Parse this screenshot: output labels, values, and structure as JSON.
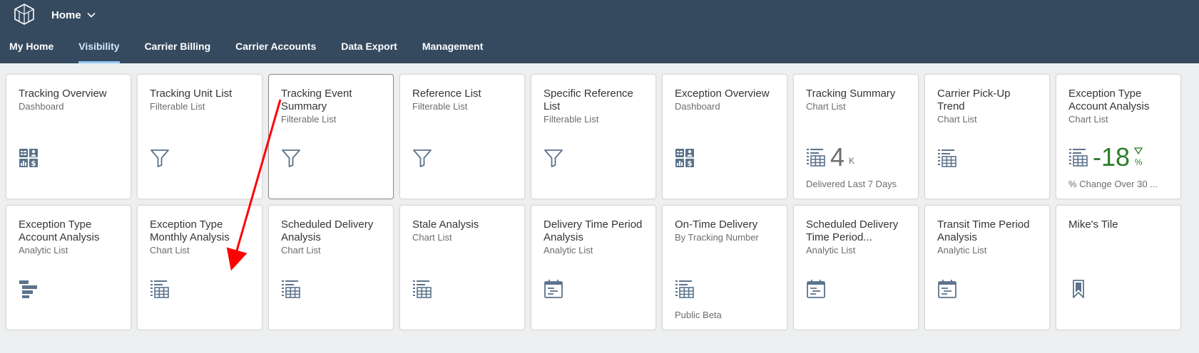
{
  "shell": {
    "home_label": "Home",
    "colors": {
      "header_bg": "#354a5f",
      "active_tab": "#91c8f6"
    }
  },
  "tabs": [
    {
      "label": "My Home",
      "active": false
    },
    {
      "label": "Visibility",
      "active": true
    },
    {
      "label": "Carrier Billing",
      "active": false
    },
    {
      "label": "Carrier Accounts",
      "active": false
    },
    {
      "label": "Data Export",
      "active": false
    },
    {
      "label": "Management",
      "active": false
    }
  ],
  "tiles": [
    {
      "title": "Tracking Overview",
      "subtitle": "Dashboard",
      "icon": "dashboard-icon"
    },
    {
      "title": "Tracking Unit List",
      "subtitle": "Filterable List",
      "icon": "filter-icon"
    },
    {
      "title": "Tracking Event Summary",
      "subtitle": "Filterable List",
      "icon": "filter-icon"
    },
    {
      "title": "Reference List",
      "subtitle": "Filterable List",
      "icon": "filter-icon"
    },
    {
      "title": "Specific Reference List",
      "subtitle": "Filterable List",
      "icon": "filter-icon"
    },
    {
      "title": "Exception Overview",
      "subtitle": "Dashboard",
      "icon": "dashboard-icon"
    },
    {
      "title": "Tracking Summary",
      "subtitle": "Chart List",
      "icon": "table-chart-icon",
      "kpi_value": "4",
      "kpi_unit": "K",
      "footer": "Delivered Last 7 Days"
    },
    {
      "title": "Carrier Pick-Up Trend",
      "subtitle": "Chart List",
      "icon": "table-chart-icon"
    },
    {
      "title": "Exception Type Account Analysis",
      "subtitle": "Chart List",
      "icon": "table-chart-icon",
      "kpi_value": "-18",
      "kpi_unit": "%",
      "footer": "% Change Over 30 ..."
    },
    {
      "title": "Exception Type Account Analysis",
      "subtitle": "Analytic List",
      "icon": "horizontal-bar-icon"
    },
    {
      "title": "Exception Type Monthly Analysis",
      "subtitle": "Chart List",
      "icon": "table-chart-icon"
    },
    {
      "title": "Scheduled Delivery Analysis",
      "subtitle": "Chart List",
      "icon": "table-chart-icon"
    },
    {
      "title": "Stale Analysis",
      "subtitle": "Chart List",
      "icon": "table-chart-icon"
    },
    {
      "title": "Delivery Time Period Analysis",
      "subtitle": "Analytic List",
      "icon": "calendar-icon"
    },
    {
      "title": "On-Time Delivery",
      "subtitle": "By Tracking Number",
      "icon": "table-chart-icon",
      "footer": "Public Beta"
    },
    {
      "title": "Scheduled Delivery Time Period...",
      "subtitle": "Analytic List",
      "icon": "calendar-icon"
    },
    {
      "title": "Transit Time Period Analysis",
      "subtitle": "Analytic List",
      "icon": "calendar-icon"
    },
    {
      "title": "Mike's Tile",
      "subtitle": "",
      "icon": "bookmark-icon"
    }
  ]
}
